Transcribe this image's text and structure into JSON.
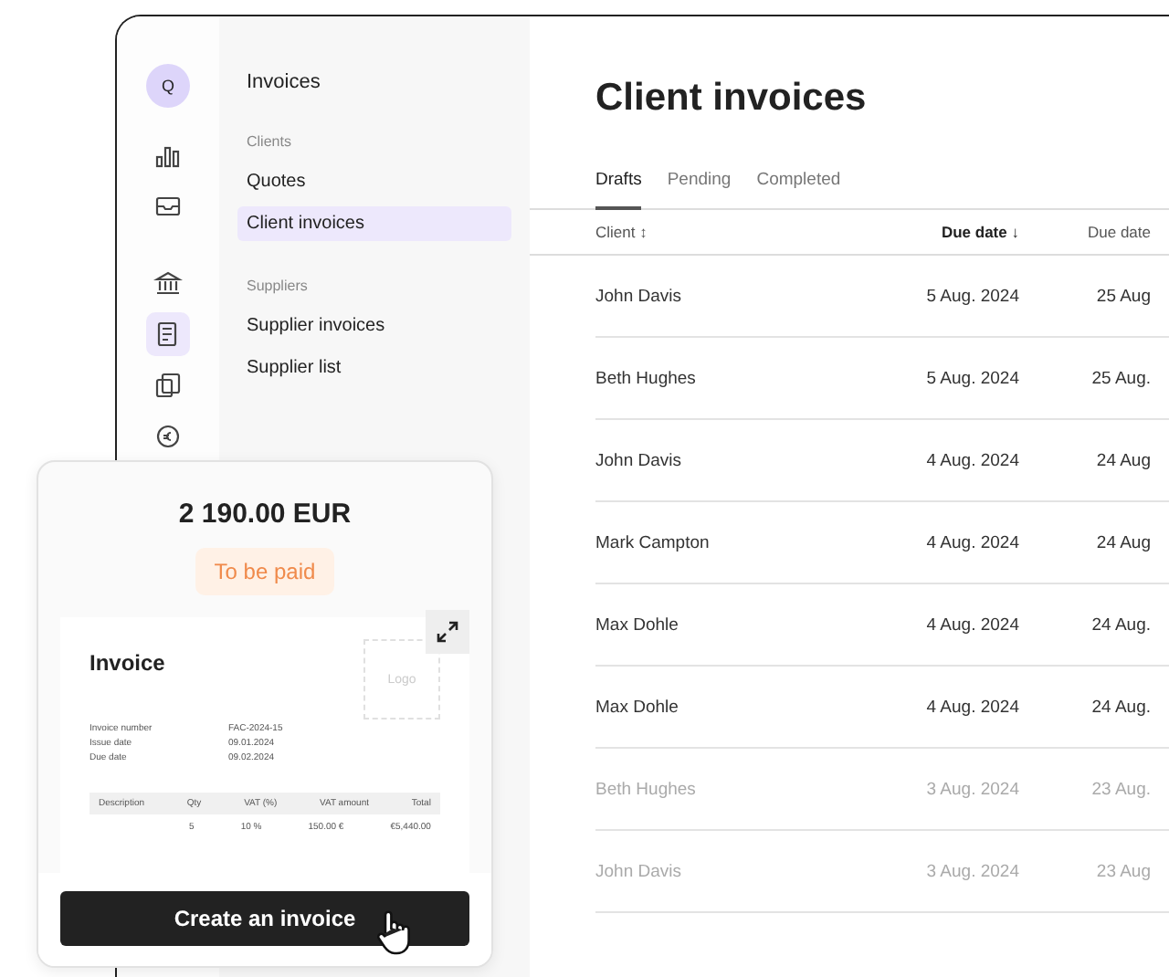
{
  "rail": {
    "avatar": "Q",
    "items": [
      {
        "selected": false
      },
      {
        "selected": false
      },
      {
        "selected": false
      },
      {
        "selected": true
      },
      {
        "selected": false
      },
      {
        "selected": false
      }
    ]
  },
  "nav": {
    "title": "Invoices",
    "sections": [
      {
        "heading": "Clients",
        "items": [
          {
            "label": "Quotes",
            "selected": false
          },
          {
            "label": "Client invoices",
            "selected": true
          }
        ]
      },
      {
        "heading": "Suppliers",
        "items": [
          {
            "label": "Supplier invoices",
            "selected": false
          },
          {
            "label": "Supplier list",
            "selected": false
          }
        ]
      }
    ]
  },
  "main": {
    "title": "Client invoices",
    "tabs": [
      {
        "label": "Drafts",
        "selected": true
      },
      {
        "label": "Pending",
        "selected": false
      },
      {
        "label": "Completed",
        "selected": false
      }
    ],
    "columns": [
      {
        "label": "Client",
        "sort": "↕",
        "active": false
      },
      {
        "label": "Due date",
        "sort": "↓",
        "active": true
      },
      {
        "label": "Due date",
        "active": false
      }
    ],
    "rows": [
      {
        "client": "John Davis",
        "date": "5 Aug. 2024",
        "due": "25 Aug",
        "dimmed": false
      },
      {
        "client": "Beth Hughes",
        "date": "5 Aug. 2024",
        "due": "25 Aug.",
        "dimmed": false
      },
      {
        "client": "John Davis",
        "date": "4 Aug. 2024",
        "due": "24 Aug",
        "dimmed": false
      },
      {
        "client": "Mark Campton",
        "date": "4 Aug. 2024",
        "due": "24 Aug",
        "dimmed": false
      },
      {
        "client": "Max Dohle",
        "date": "4 Aug. 2024",
        "due": "24 Aug.",
        "dimmed": false
      },
      {
        "client": "Max Dohle",
        "date": "4 Aug. 2024",
        "due": "24 Aug.",
        "dimmed": false
      },
      {
        "client": "Beth Hughes",
        "date": "3 Aug. 2024",
        "due": "23 Aug.",
        "dimmed": true
      },
      {
        "client": "John Davis",
        "date": "3 Aug. 2024",
        "due": "23 Aug",
        "dimmed": true
      }
    ]
  },
  "card": {
    "amount": "2 190.00 EUR",
    "status": "To be paid",
    "preview": {
      "title": "Invoice",
      "logo": "Logo",
      "fields": [
        {
          "label": "Invoice number",
          "value": "FAC-2024-15"
        },
        {
          "label": "Issue date",
          "value": "09.01.2024"
        },
        {
          "label": "Due date",
          "value": "09.02.2024"
        }
      ],
      "columns": [
        "Description",
        "Qty",
        "VAT (%)",
        "VAT amount",
        "Total"
      ],
      "row": [
        "5",
        "10 %",
        "150.00 €",
        "€5,440.00"
      ]
    },
    "button": "Create an invoice"
  }
}
